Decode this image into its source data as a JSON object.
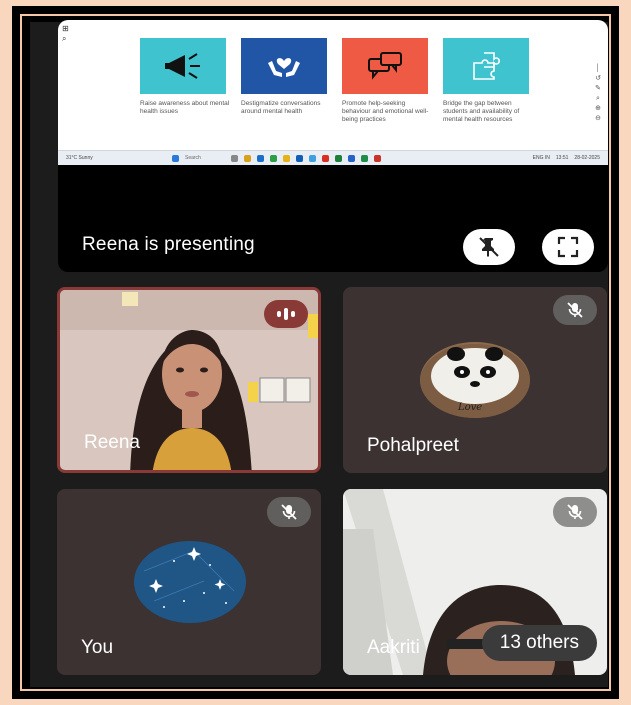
{
  "presentation": {
    "presenting_label": "Reena is presenting",
    "cards": [
      {
        "icon": "megaphone-icon",
        "color": "#3fc3cf",
        "text": "Raise awareness about mental health issues"
      },
      {
        "icon": "hands-heart-icon",
        "color": "#2156a6",
        "text": "Destigmatize conversations around mental health"
      },
      {
        "icon": "speech-bubbles-icon",
        "color": "#ef5a44",
        "text": "Promote help-seeking behaviour and emotional well-being practices"
      },
      {
        "icon": "puzzle-icon",
        "color": "#3fc3cf",
        "text": "Bridge the gap between students and availability of mental health resources"
      }
    ],
    "taskbar": {
      "weather": "31°C Sunny",
      "search_placeholder": "Search",
      "time": "13:51",
      "date": "28-02-2025",
      "lang": "ENG IN"
    }
  },
  "participants": [
    {
      "name": "Reena",
      "state": "speaking"
    },
    {
      "name": "Pohalpreet",
      "state": "muted"
    },
    {
      "name": "You",
      "state": "muted"
    },
    {
      "name": "Aakriti",
      "state": "muted"
    }
  ],
  "others_label": "13 others",
  "colors": {
    "background": "#f9d7bf",
    "tile": "#3c3232",
    "active_border": "#8a3a36"
  }
}
